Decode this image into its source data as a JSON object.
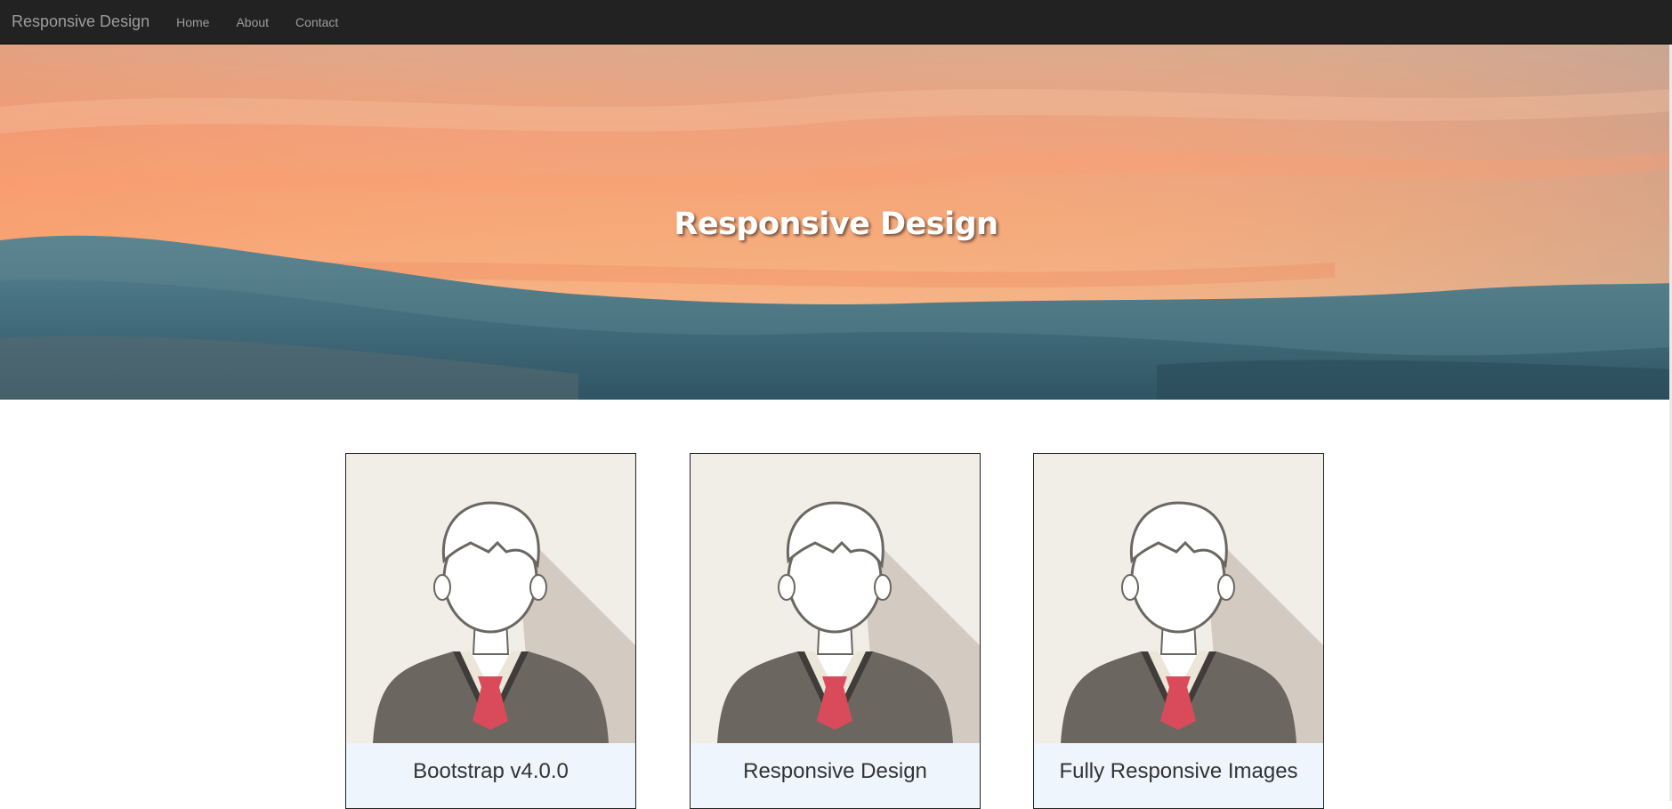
{
  "navbar": {
    "brand": "Responsive Design",
    "links": [
      "Home",
      "About",
      "Contact"
    ]
  },
  "hero": {
    "title": "Responsive Design",
    "image": "sunset-over-snowy-hills"
  },
  "cards": [
    {
      "caption": "Bootstrap v4.0.0",
      "image": "avatar-man-with-tie-icon"
    },
    {
      "caption": "Responsive Design",
      "image": "avatar-man-with-tie-icon"
    },
    {
      "caption": "Fully Responsive Images",
      "image": "avatar-man-with-tie-icon"
    }
  ],
  "colors": {
    "navbar_bg": "#222222",
    "nav_text": "#9d9d9d",
    "caption_bg": "#eef5fc",
    "tie": "#d94b5a",
    "sweater": "#6b6760"
  }
}
